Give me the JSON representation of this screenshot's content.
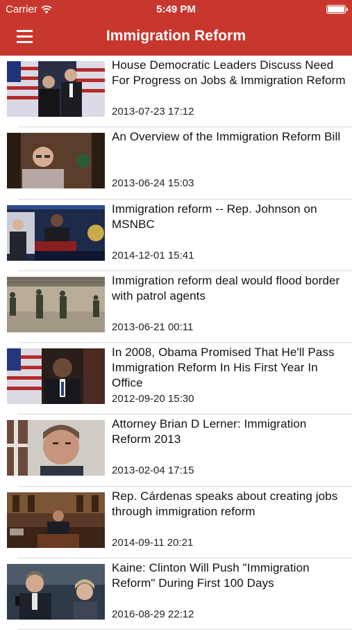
{
  "status_bar": {
    "carrier": "Carrier",
    "time": "5:49 PM"
  },
  "nav": {
    "title": "Immigration Reform",
    "menu_icon": "hamburger-menu-icon"
  },
  "articles": [
    {
      "title": "House Democratic Leaders Discuss Need For Progress on Jobs & Immigration Reform",
      "date": "2013-07-23 17:12"
    },
    {
      "title": "An Overview of the Immigration Reform Bill",
      "date": "2013-06-24 15:03"
    },
    {
      "title": "Immigration reform -- Rep. Johnson on MSNBC",
      "date": "2014-12-01 15:41"
    },
    {
      "title": "Immigration reform deal would flood border with patrol agents",
      "date": "2013-06-21 00:11"
    },
    {
      "title": "In 2008, Obama Promised That He'll Pass Immigration Reform In His First Year In Office",
      "date": "2012-09-20 15:30"
    },
    {
      "title": "Attorney Brian D Lerner: Immigration Reform 2013",
      "date": "2013-02-04 17:15"
    },
    {
      "title": "Rep. Cárdenas speaks about creating jobs through immigration reform",
      "date": "2014-09-11 20:21"
    },
    {
      "title": "Kaine: Clinton Will Push \"Immigration Reform\" During First 100 Days",
      "date": "2016-08-29 22:12"
    }
  ],
  "colors": {
    "header": "#c8372e",
    "text": "#111111",
    "separator": "#d9d9d9"
  }
}
